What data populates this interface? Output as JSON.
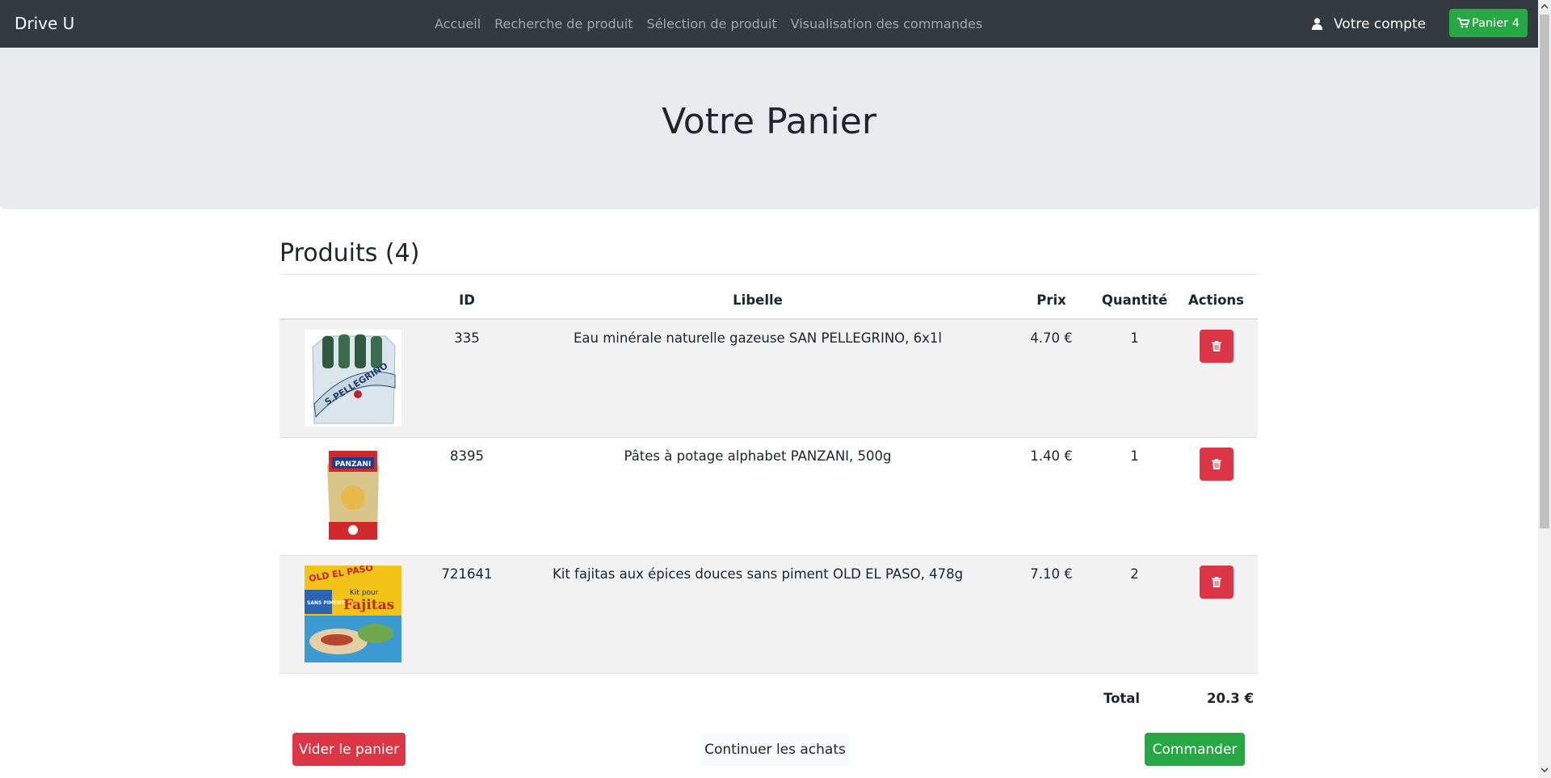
{
  "navbar": {
    "brand": "Drive U",
    "links": [
      "Accueil",
      "Recherche de produit",
      "Sélection de produit",
      "Visualisation des commandes"
    ],
    "account_label": "Votre compte",
    "cart_label": "Panier 4"
  },
  "jumbotron": {
    "title": "Votre Panier"
  },
  "cart": {
    "heading": "Produits (4)",
    "columns": [
      "",
      "ID",
      "Libelle",
      "Prix",
      "Quantité",
      "Actions"
    ],
    "rows": [
      {
        "image": "san-pellegrino-pack",
        "id": "335",
        "libelle": "Eau minérale naturelle gazeuse SAN PELLEGRINO, 6x1l",
        "prix": "4.70 €",
        "quantite": "1"
      },
      {
        "image": "panzani-pasta-bag",
        "id": "8395",
        "libelle": "Pâtes à potage alphabet PANZANI, 500g",
        "prix": "1.40 €",
        "quantite": "1"
      },
      {
        "image": "old-el-paso-kit",
        "id": "721641",
        "libelle": "Kit fajitas aux épices douces sans piment OLD EL PASO, 478g",
        "prix": "7.10 €",
        "quantite": "2"
      }
    ],
    "total_label": "Total",
    "total_value": "20.3 €"
  },
  "actions": {
    "empty_label": "Vider le panier",
    "continue_label": "Continuer les achats",
    "order_label": "Commander"
  },
  "colors": {
    "navbar_bg": "#343a40",
    "danger": "#dc3545",
    "success": "#28a745",
    "jumbotron_bg": "#e9ecef"
  },
  "product_images": {
    "fajitas_box_text": [
      "OLD EL PASO",
      "Kit pour",
      "Fajitas",
      "SANS PIMENT"
    ],
    "pellegrino_label": "S.PELLEGRINO",
    "panzani_label": "PANZANI"
  }
}
